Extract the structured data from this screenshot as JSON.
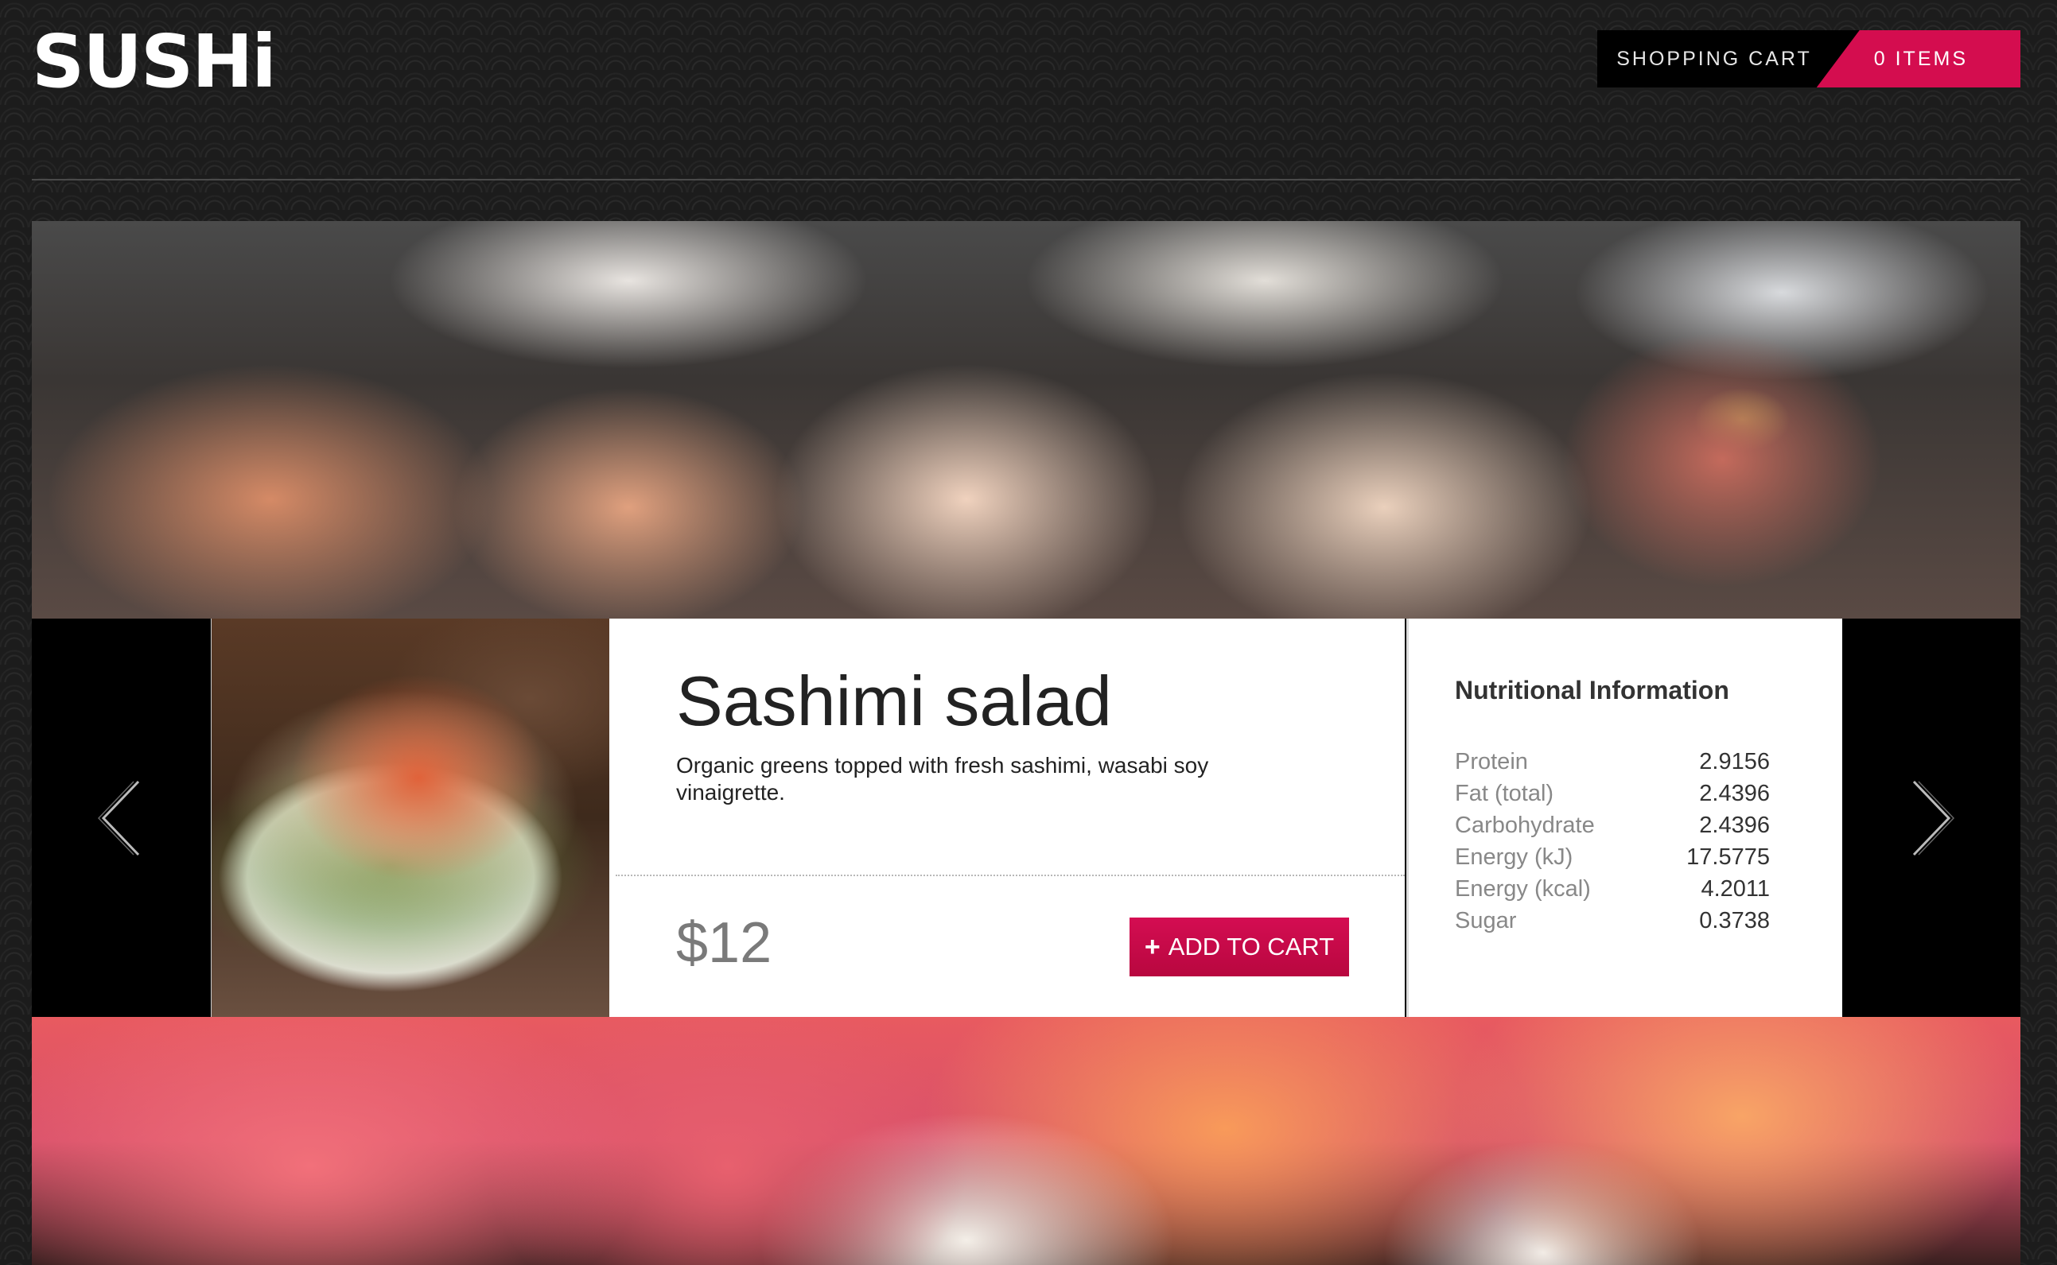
{
  "header": {
    "logo": "SUSHi",
    "cart_label": "SHOPPING CART",
    "cart_count": "0 ITEMS"
  },
  "product": {
    "name": "Sashimi salad",
    "description": "Organic greens topped with fresh sashimi, wasabi soy vinaigrette.",
    "price": "$12",
    "add_button_icon": "+",
    "add_button_label": "ADD TO CART"
  },
  "nutrition": {
    "title": "Nutritional Information",
    "rows": [
      {
        "label": "Protein",
        "value": "2.9156"
      },
      {
        "label": "Fat (total)",
        "value": "2.4396"
      },
      {
        "label": "Carbohydrate",
        "value": "2.4396"
      },
      {
        "label": "Energy (kJ)",
        "value": "17.5775"
      },
      {
        "label": "Energy (kcal)",
        "value": "4.2011"
      },
      {
        "label": "Sugar",
        "value": "0.3738"
      }
    ]
  },
  "icons": {
    "prev": "chevron-left-icon",
    "next": "chevron-right-icon"
  },
  "colors": {
    "accent": "#d40d4f",
    "background": "#1c1c1c",
    "panel": "#ffffff"
  }
}
